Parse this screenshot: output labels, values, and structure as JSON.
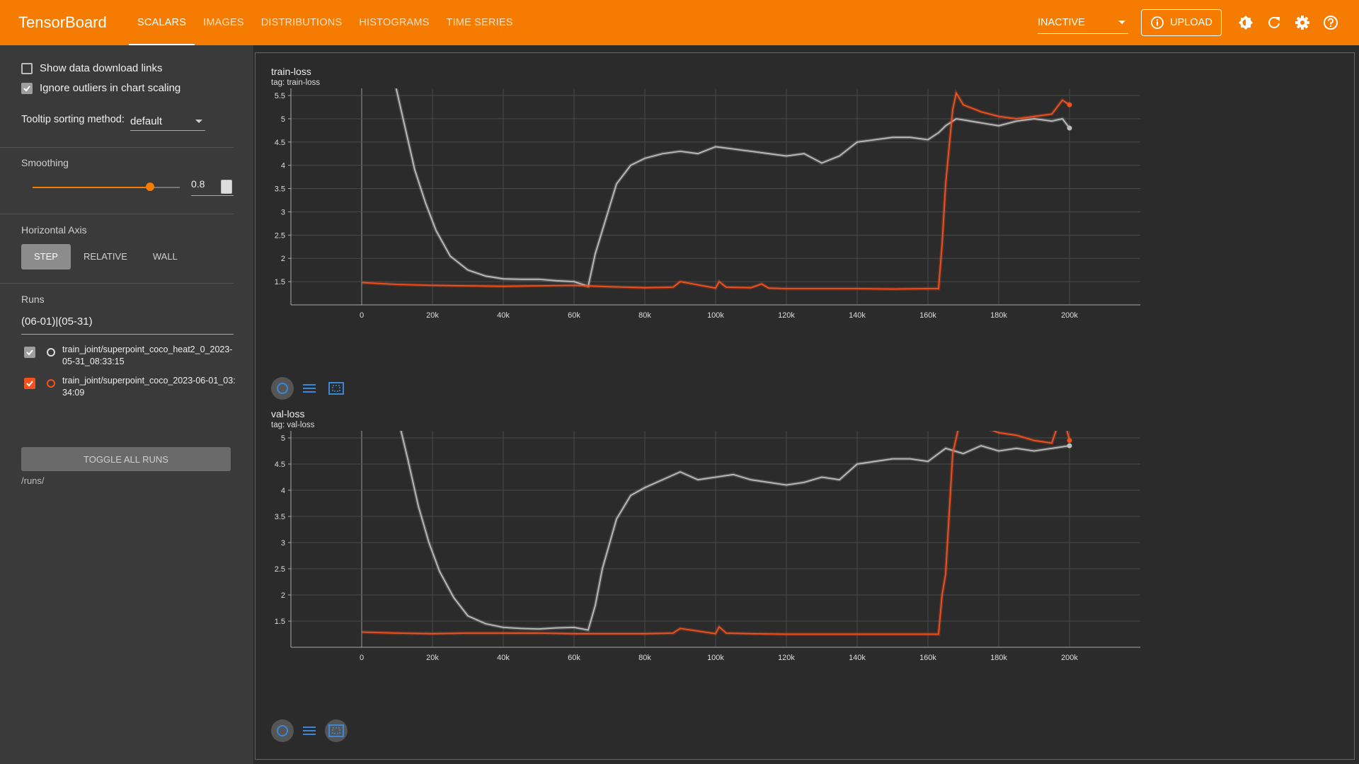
{
  "app": {
    "title": "TensorBoard",
    "tabs": [
      "SCALARS",
      "IMAGES",
      "DISTRIBUTIONS",
      "HISTOGRAMS",
      "TIME SERIES"
    ],
    "active_tab": "SCALARS",
    "status_select": "INACTIVE",
    "upload_label": "UPLOAD",
    "accent_color": "#f57c00"
  },
  "sidebar": {
    "show_download_links": {
      "label": "Show data download links",
      "checked": false
    },
    "ignore_outliers": {
      "label": "Ignore outliers in chart scaling",
      "checked": true
    },
    "tooltip_sorting": {
      "label": "Tooltip sorting method:",
      "value": "default"
    },
    "smoothing": {
      "label": "Smoothing",
      "value": "0.8",
      "level": 0.8
    },
    "horizontal_axis": {
      "label": "Horizontal Axis",
      "options": [
        "STEP",
        "RELATIVE",
        "WALL"
      ],
      "selected": "STEP"
    },
    "runs": {
      "label": "Runs",
      "filter": "(06-01)|(05-31)",
      "items": [
        {
          "name": "train_joint/superpoint_coco_heat2_0_2023-05-31_08:33:15",
          "checked": true,
          "color": "#9e9e9e"
        },
        {
          "name": "train_joint/superpoint_coco_2023-06-01_03:34:09",
          "checked": true,
          "color": "#f4511e"
        }
      ],
      "toggle_all_label": "TOGGLE ALL RUNS",
      "path": "/runs/"
    }
  },
  "charts": [
    {
      "title": "train-loss",
      "tag": "tag: train-loss"
    },
    {
      "title": "val-loss",
      "tag": "tag: val-loss"
    }
  ],
  "chart_data": [
    {
      "type": "line",
      "title": "train-loss",
      "subtitle": "tag: train-loss",
      "xlabel": "",
      "ylabel": "",
      "x_ticks": [
        "0",
        "20k",
        "40k",
        "60k",
        "80k",
        "100k",
        "120k",
        "140k",
        "160k",
        "180k",
        "200k"
      ],
      "y_ticks": [
        "1.5",
        "2",
        "2.5",
        "3",
        "3.5",
        "4",
        "4.5",
        "5",
        "5.5"
      ],
      "xlim": [
        -20000,
        220000
      ],
      "ylim": [
        1.0,
        5.5
      ],
      "grid": true,
      "series": [
        {
          "color": "#bdbdbd",
          "x": [
            9000,
            12000,
            15000,
            18000,
            21000,
            25000,
            30000,
            35000,
            40000,
            45000,
            50000,
            55000,
            60000,
            64000,
            66000,
            68000,
            72000,
            76000,
            80000,
            85000,
            90000,
            95000,
            100000,
            105000,
            110000,
            115000,
            120000,
            125000,
            130000,
            135000,
            140000,
            145000,
            150000,
            155000,
            160000,
            163000,
            165000,
            168000,
            172000,
            176000,
            180000,
            185000,
            190000,
            195000,
            198000,
            200000
          ],
          "y": [
            5.9,
            4.9,
            3.9,
            3.2,
            2.6,
            2.05,
            1.75,
            1.62,
            1.56,
            1.55,
            1.55,
            1.52,
            1.5,
            1.4,
            2.1,
            2.6,
            3.6,
            4.0,
            4.15,
            4.25,
            4.3,
            4.25,
            4.4,
            4.35,
            4.3,
            4.25,
            4.2,
            4.25,
            4.05,
            4.2,
            4.5,
            4.55,
            4.6,
            4.6,
            4.55,
            4.7,
            4.85,
            5.0,
            4.95,
            4.9,
            4.85,
            4.95,
            5.0,
            4.95,
            5.0,
            4.8
          ]
        },
        {
          "color": "#f4511e",
          "x": [
            0,
            10000,
            20000,
            30000,
            40000,
            50000,
            60000,
            70000,
            80000,
            88000,
            90000,
            100000,
            101000,
            103000,
            110000,
            113000,
            115000,
            120000,
            130000,
            140000,
            150000,
            160000,
            163000,
            164000,
            165000,
            167000,
            168000,
            170000,
            175000,
            180000,
            185000,
            190000,
            195000,
            198000,
            200000
          ],
          "y": [
            1.48,
            1.44,
            1.42,
            1.41,
            1.4,
            1.41,
            1.42,
            1.39,
            1.37,
            1.38,
            1.5,
            1.36,
            1.5,
            1.38,
            1.37,
            1.45,
            1.36,
            1.35,
            1.35,
            1.35,
            1.34,
            1.35,
            1.35,
            2.3,
            3.6,
            5.2,
            5.55,
            5.3,
            5.15,
            5.05,
            5.0,
            5.05,
            5.1,
            5.4,
            5.3
          ]
        }
      ]
    },
    {
      "type": "line",
      "title": "val-loss",
      "subtitle": "tag: val-loss",
      "xlabel": "",
      "ylabel": "",
      "x_ticks": [
        "0",
        "20k",
        "40k",
        "60k",
        "80k",
        "100k",
        "120k",
        "140k",
        "160k",
        "180k",
        "200k"
      ],
      "y_ticks": [
        "1.5",
        "2",
        "2.5",
        "3",
        "3.5",
        "4",
        "4.5",
        "5"
      ],
      "xlim": [
        -20000,
        220000
      ],
      "ylim": [
        1.0,
        5.0
      ],
      "grid": true,
      "series": [
        {
          "color": "#bdbdbd",
          "x": [
            10000,
            13000,
            16000,
            19000,
            22000,
            26000,
            30000,
            35000,
            40000,
            45000,
            50000,
            55000,
            60000,
            64000,
            66000,
            68000,
            72000,
            76000,
            80000,
            85000,
            90000,
            95000,
            100000,
            105000,
            110000,
            115000,
            120000,
            125000,
            130000,
            135000,
            140000,
            145000,
            150000,
            155000,
            160000,
            165000,
            170000,
            175000,
            180000,
            185000,
            190000,
            195000,
            200000
          ],
          "y": [
            5.45,
            4.6,
            3.7,
            3.0,
            2.45,
            1.95,
            1.6,
            1.45,
            1.38,
            1.36,
            1.35,
            1.37,
            1.38,
            1.33,
            1.8,
            2.5,
            3.45,
            3.9,
            4.05,
            4.2,
            4.35,
            4.2,
            4.25,
            4.3,
            4.2,
            4.15,
            4.1,
            4.15,
            4.25,
            4.2,
            4.5,
            4.55,
            4.6,
            4.6,
            4.55,
            4.8,
            4.7,
            4.85,
            4.75,
            4.8,
            4.75,
            4.8,
            4.85
          ]
        },
        {
          "color": "#f4511e",
          "x": [
            0,
            10000,
            20000,
            30000,
            40000,
            50000,
            60000,
            70000,
            80000,
            88000,
            90000,
            100000,
            101000,
            103000,
            110000,
            120000,
            130000,
            140000,
            150000,
            160000,
            163000,
            164000,
            165000,
            167000,
            169000,
            172000,
            176000,
            180000,
            185000,
            190000,
            195000,
            198000,
            200000
          ],
          "y": [
            1.29,
            1.27,
            1.26,
            1.27,
            1.27,
            1.27,
            1.26,
            1.26,
            1.26,
            1.27,
            1.36,
            1.26,
            1.39,
            1.27,
            1.26,
            1.25,
            1.25,
            1.25,
            1.25,
            1.25,
            1.25,
            2.0,
            2.4,
            4.7,
            5.3,
            5.3,
            5.2,
            5.1,
            5.05,
            4.95,
            4.9,
            5.5,
            4.95
          ]
        }
      ]
    }
  ]
}
